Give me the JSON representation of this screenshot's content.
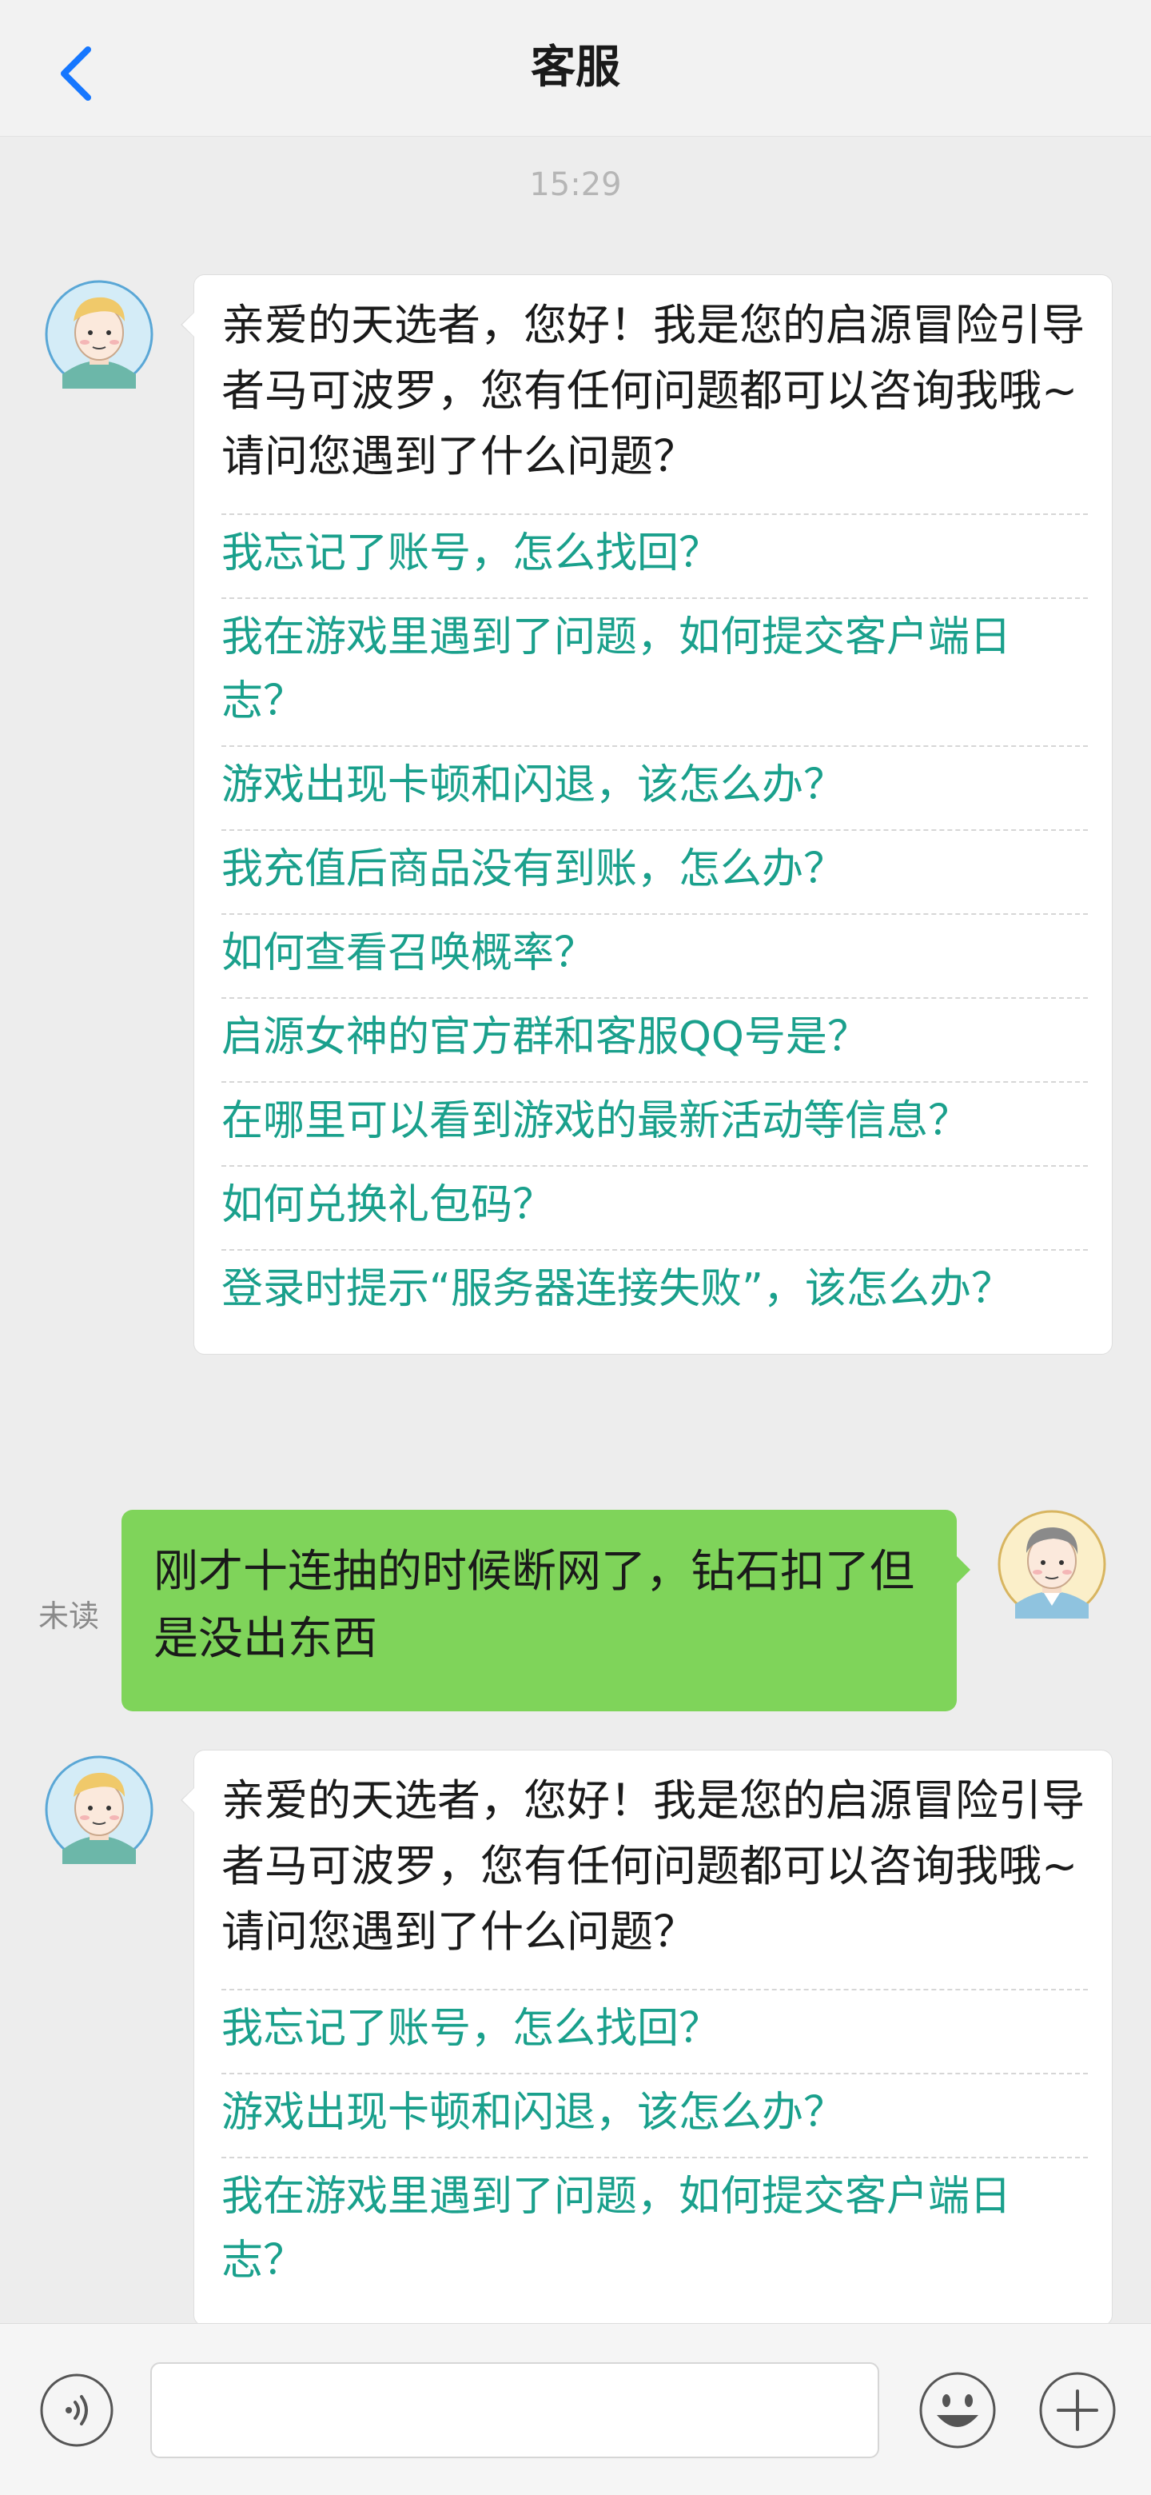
{
  "header": {
    "title": "客服",
    "back_icon": "chevron-left-icon"
  },
  "timestamp": "15:29",
  "messages": {
    "bot1": {
      "intro": "亲爱的天选者，您好！我是您的启源冒险引导者马可波罗，您有任何问题都可以咨询我哦~请问您遇到了什么问题？",
      "faqs": [
        "我忘记了账号，怎么找回？",
        "我在游戏里遇到了问题，如何提交客户端日志？",
        "游戏出现卡顿和闪退，该怎么办？",
        "我充值后商品没有到账，怎么办？",
        "如何查看召唤概率？",
        "启源女神的官方群和客服QQ号是？",
        "在哪里可以看到游戏的最新活动等信息？",
        "如何兑换礼包码？",
        "登录时提示“服务器连接失败”，该怎么办？"
      ]
    },
    "user1": {
      "status": "未读",
      "text": "刚才十连抽的时候断网了，钻石扣了但是没出东西"
    },
    "bot2": {
      "intro": "亲爱的天选者，您好！我是您的启源冒险引导者马可波罗，您有任何问题都可以咨询我哦~请问您遇到了什么问题？",
      "faqs": [
        "我忘记了账号，怎么找回？",
        "游戏出现卡顿和闪退，该怎么办？",
        "我在游戏里遇到了问题，如何提交客户端日志？"
      ]
    }
  },
  "input_bar": {
    "placeholder": "",
    "voice_icon": "voice-icon",
    "emoji_icon": "emoji-icon",
    "plus_icon": "plus-icon"
  },
  "colors": {
    "accent_blue": "#1677ff",
    "faq_teal": "#1aa08c",
    "user_bubble_green": "#7fd45a"
  }
}
